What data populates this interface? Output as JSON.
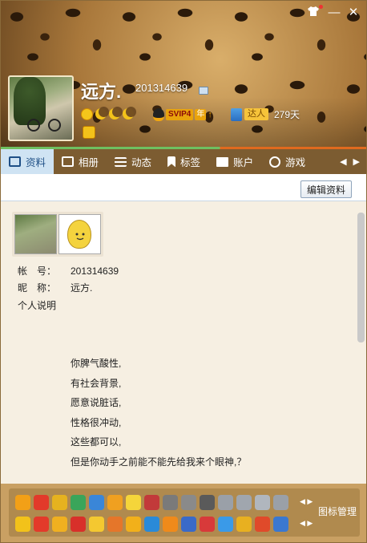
{
  "window": {
    "controls": {
      "skin_icon": "tshirt-icon",
      "minimize_glyph": "—",
      "close_glyph": "✕"
    }
  },
  "profile": {
    "nickname": "远方.",
    "qq_number": "201314639",
    "vip_label": "SVIP4",
    "vip_year": "年",
    "vip_up": "↑",
    "daren_label": "达人",
    "days": "279天"
  },
  "tabs": [
    {
      "label": "资料",
      "icon": "id-card-icon"
    },
    {
      "label": "相册",
      "icon": "photo-icon"
    },
    {
      "label": "动态",
      "icon": "list-icon"
    },
    {
      "label": "标签",
      "icon": "bookmark-icon"
    },
    {
      "label": "账户",
      "icon": "bag-icon"
    },
    {
      "label": "游戏",
      "icon": "game-icon"
    }
  ],
  "tab_arrows": {
    "left": "◀",
    "right": "▶"
  },
  "content": {
    "edit_button": "编辑资料",
    "fields": [
      {
        "label": "帐　号：",
        "value": "201314639"
      },
      {
        "label": "昵　称：",
        "value": "远方."
      }
    ],
    "signature_label": "个人说明",
    "signature_lines": [
      "你脾气酸性,",
      "有社会背景,",
      "愿意说脏话,",
      "性格很冲动,",
      "这些都可以,",
      "但是你动手之前能不能先给我来个眼神,？"
    ]
  },
  "icon_panel": {
    "manage_label": "图标管理",
    "arrows": "◀ ▶",
    "row1_colors": [
      "#f2a017",
      "#e23a2a",
      "#e6b21f",
      "#3aa55a",
      "#3a86d8",
      "#f0a020",
      "#f5d53a",
      "#c23a3a",
      "#7a7a7a",
      "#8a8a8a",
      "#5a5a5a",
      "#9aa0a8",
      "#a0a6ae",
      "#b0b6be",
      "#9aa0a8"
    ],
    "row2_colors": [
      "#f2c21a",
      "#e33a2a",
      "#f0b020",
      "#d8302a",
      "#f4c830",
      "#e5762a",
      "#f2b01a",
      "#2a8ad8",
      "#f08a1a",
      "#3a6ac8",
      "#d83a3a",
      "#3a9ae8",
      "#e8b020",
      "#e04a2a",
      "#3a78d0",
      "#c83a2a"
    ]
  }
}
